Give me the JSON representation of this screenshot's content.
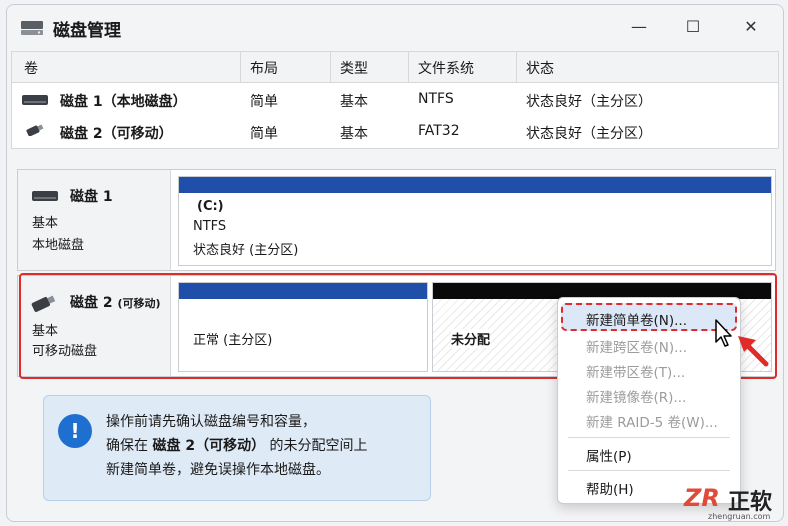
{
  "window": {
    "title": "磁盘管理",
    "controls": {
      "minimize": "—",
      "maximize": "☐",
      "close": "✕"
    }
  },
  "volume_table": {
    "headers": [
      "卷",
      "布局",
      "类型",
      "文件系统",
      "状态"
    ],
    "rows": [
      {
        "name": "磁盘 1（本地磁盘）",
        "layout": "简单",
        "type": "基本",
        "fs": "NTFS",
        "status": "状态良好（主分区）",
        "icon": "hdd-icon"
      },
      {
        "name": "磁盘 2（可移动）",
        "layout": "简单",
        "type": "基本",
        "fs": "FAT32",
        "status": "状态良好（主分区）",
        "icon": "usb-drive-icon"
      }
    ]
  },
  "disks": [
    {
      "name": "磁盘 1",
      "line1": "基本",
      "line2": "本地磁盘",
      "partition": {
        "drive": "(C:)",
        "fs": "NTFS",
        "status": "状态良好 (主分区)"
      }
    },
    {
      "name": "磁盘 2",
      "name_suffix": "(可移动)",
      "line1": "基本",
      "line2": "可移动磁盘",
      "partition": {
        "status": "正常 (主分区)"
      },
      "unallocated": "未分配"
    }
  ],
  "colors": {
    "primary_bar": "#1f4fa8",
    "unallocated_bar": "#0a0a0a",
    "highlight": "#e02b2b",
    "info_icon": "#1e6fd0"
  },
  "info": {
    "icon": "!",
    "line1": "操作前请先确认磁盘编号和容量，",
    "line2_pre": "确保在 ",
    "line2_bold": "磁盘 2（可移动）",
    "line2_post": " 的未分配空间上",
    "line3": "新建简单卷，避免误操作本地磁盘。"
  },
  "context_menu": {
    "items": [
      {
        "label": "新建简单卷(N)...",
        "enabled": true,
        "highlighted": true
      },
      {
        "label": "新建跨区卷(N)...",
        "enabled": false
      },
      {
        "label": "新建带区卷(T)...",
        "enabled": false
      },
      {
        "label": "新建镜像卷(R)...",
        "enabled": false
      },
      {
        "label": "新建 RAID-5 卷(W)...",
        "enabled": false
      },
      {
        "label": "属性(P)",
        "enabled": true
      },
      {
        "label": "帮助(H)",
        "enabled": true
      }
    ]
  },
  "logo": {
    "mark": "ZR",
    "name": "正软",
    "url": "zhengruan.com"
  }
}
